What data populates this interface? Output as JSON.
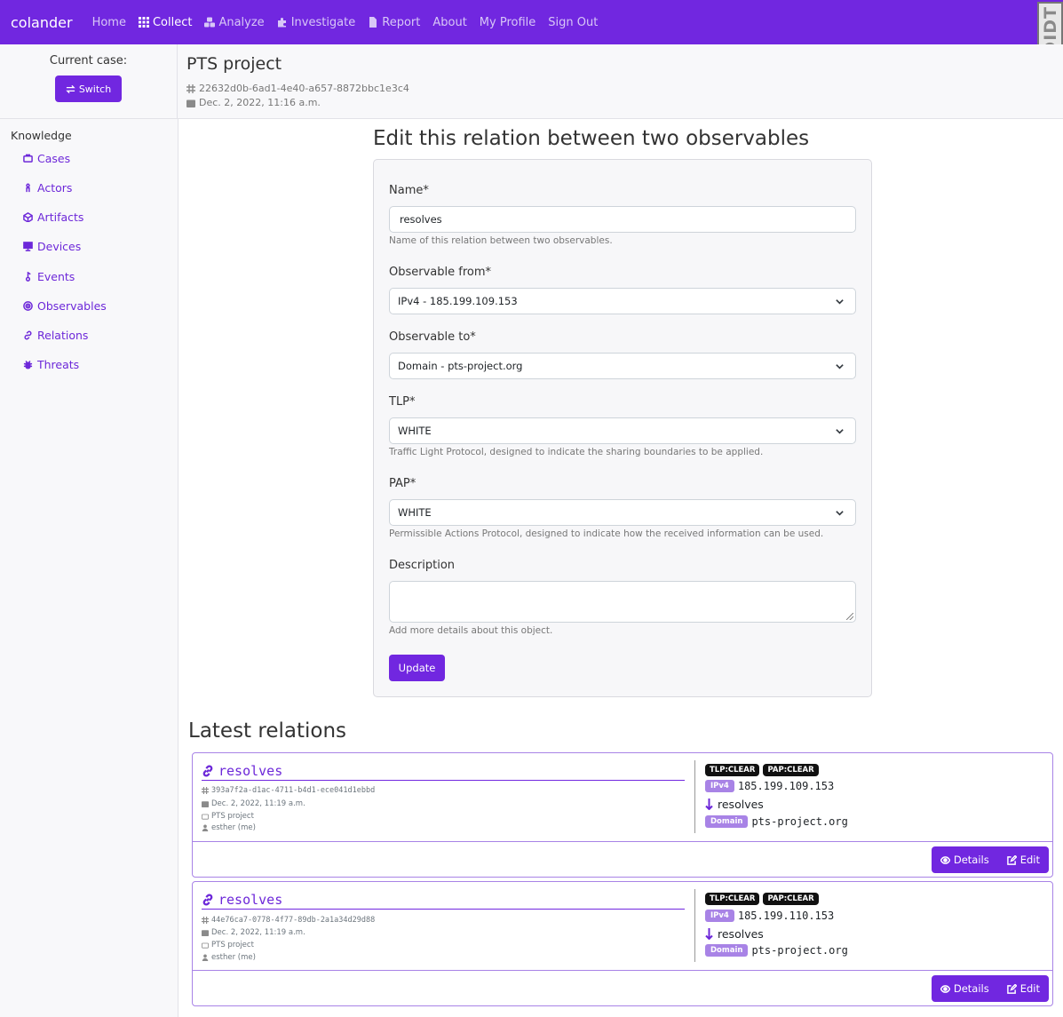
{
  "nav": {
    "brand": "colander",
    "items": [
      {
        "label": "Home",
        "icon": "none"
      },
      {
        "label": "Collect",
        "icon": "grid-icon"
      },
      {
        "label": "Analyze",
        "icon": "cubes-icon"
      },
      {
        "label": "Investigate",
        "icon": "puzzle-icon"
      },
      {
        "label": "Report",
        "icon": "file-icon"
      },
      {
        "label": "About",
        "icon": "none"
      },
      {
        "label": "My Profile",
        "icon": "none"
      },
      {
        "label": "Sign Out",
        "icon": "none"
      }
    ],
    "active": "Collect",
    "logo_text": "DIDT"
  },
  "case": {
    "current_label": "Current case:",
    "switch_label": "Switch",
    "title": "PTS project",
    "id": "22632d0b-6ad1-4e40-a657-8872bbc1e3c4",
    "date": "Dec. 2, 2022, 11:16 a.m."
  },
  "sidebar": {
    "heading": "Knowledge",
    "items": [
      {
        "label": "Cases",
        "icon": "case-icon"
      },
      {
        "label": "Actors",
        "icon": "actor-icon"
      },
      {
        "label": "Artifacts",
        "icon": "artifact-icon"
      },
      {
        "label": "Devices",
        "icon": "server-icon"
      },
      {
        "label": "Events",
        "icon": "event-icon"
      },
      {
        "label": "Observables",
        "icon": "target-icon"
      },
      {
        "label": "Relations",
        "icon": "link-icon"
      },
      {
        "label": "Threats",
        "icon": "bug-icon"
      }
    ]
  },
  "form": {
    "title": "Edit this relation between two observables",
    "name_label": "Name*",
    "name_value": "resolves",
    "name_help": "Name of this relation between two observables.",
    "from_label": "Observable from*",
    "from_value": "IPv4 - 185.199.109.153",
    "to_label": "Observable to*",
    "to_value": "Domain - pts-project.org",
    "tlp_label": "TLP*",
    "tlp_value": "WHITE",
    "tlp_help": "Traffic Light Protocol, designed to indicate the sharing boundaries to be applied.",
    "pap_label": "PAP*",
    "pap_value": "WHITE",
    "pap_help": "Permissible Actions Protocol, designed to indicate how the received information can be used.",
    "desc_label": "Description",
    "desc_value": "",
    "desc_help": "Add more details about this object.",
    "submit_label": "Update"
  },
  "latest": {
    "title": "Latest relations",
    "relations": [
      {
        "name": "resolves",
        "id": "393a7f2a-d1ac-4711-b4d1-ece041d1ebbd",
        "date": "Dec. 2, 2022, 11:19 a.m.",
        "case": "PTS project",
        "owner": "esther (me)",
        "tlp": "TLP:CLEAR",
        "pap": "PAP:CLEAR",
        "from_type": "IPv4",
        "from_value": "185.199.109.153",
        "relation": "resolves",
        "to_type": "Domain",
        "to_value": "pts-project.org",
        "details_label": "Details",
        "edit_label": "Edit"
      },
      {
        "name": "resolves",
        "id": "44e76ca7-0778-4f77-89db-2a1a34d29d88",
        "date": "Dec. 2, 2022, 11:19 a.m.",
        "case": "PTS project",
        "owner": "esther (me)",
        "tlp": "TLP:CLEAR",
        "pap": "PAP:CLEAR",
        "from_type": "IPv4",
        "from_value": "185.199.110.153",
        "relation": "resolves",
        "to_type": "Domain",
        "to_value": "pts-project.org",
        "details_label": "Details",
        "edit_label": "Edit"
      }
    ]
  },
  "colors": {
    "accent": "#7127e0",
    "link": "#6d28d9",
    "badge": "#a883e6"
  }
}
